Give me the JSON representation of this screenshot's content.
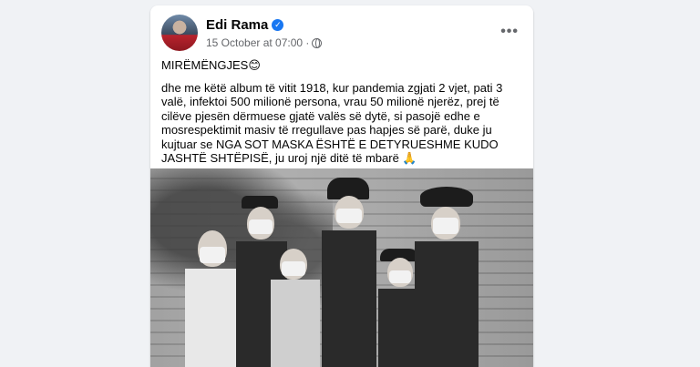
{
  "post": {
    "author": "Edi Rama",
    "timestamp": "15 October at 07:00 ·",
    "more_label": "•••",
    "greeting": "MIRËMËNGJES😊",
    "body": "dhe me këtë album të vitit 1918, kur pandemia zgjati 2 vjet, pati 3 valë, infektoi 500 milionë persona, vrau 50 milionë njerëz, prej të cilëve pjesën dërmuese gjatë valës së dytë, si pasojë edhe e mosrespektimit masiv të rregullave pas hapjes së parë, duke ju kujtuar se NGA SOT MASKA ËSHTË E DETYRUESHME KUDO JASHTË SHTËPISË, ju uroj një ditë të mbarë 🙏"
  },
  "icons": {
    "verified": "verified-badge-icon",
    "privacy": "globe-icon",
    "more": "more-options-icon"
  },
  "colors": {
    "background": "#f0f2f5",
    "card": "#ffffff",
    "verified": "#1877f2",
    "meta_text": "#65676b"
  }
}
